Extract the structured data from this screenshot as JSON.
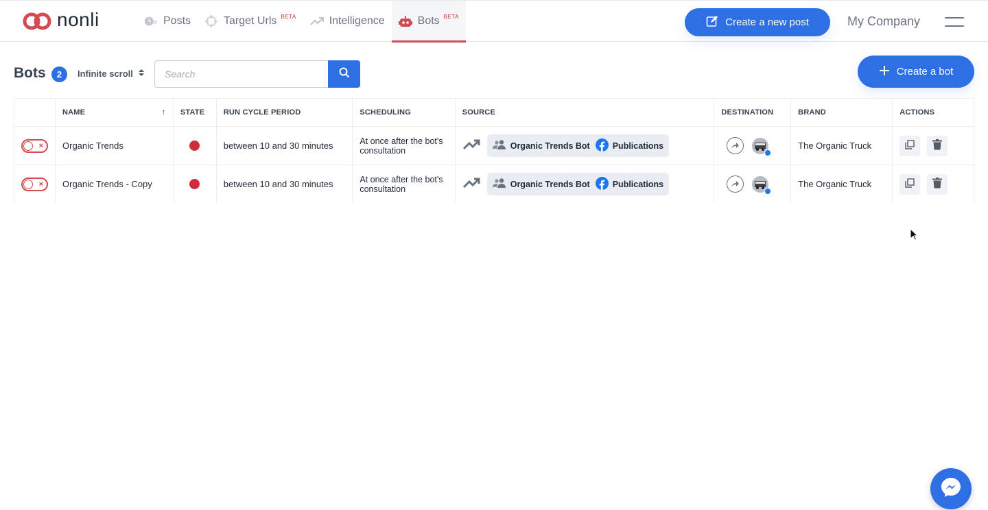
{
  "brand": {
    "name": "nonli",
    "accent": "#2f6fe4",
    "danger": "#d44a52"
  },
  "nav": {
    "items": [
      {
        "label": "Posts",
        "beta": "",
        "icon": "clock-icon"
      },
      {
        "label": "Target Urls",
        "beta": "BETA",
        "icon": "crosshair-icon"
      },
      {
        "label": "Intelligence",
        "beta": "",
        "icon": "trend-icon"
      },
      {
        "label": "Bots",
        "beta": "BETA",
        "icon": "robot-icon",
        "active": true
      }
    ],
    "create_post_label": "Create a new post",
    "company": "My Company"
  },
  "toolbar": {
    "title": "Bots",
    "count": "2",
    "scroll_mode": "Infinite scroll",
    "search_placeholder": "Search",
    "create_bot_label": "Create a bot"
  },
  "table": {
    "headers": [
      "NAME",
      "STATE",
      "RUN CYCLE PERIOD",
      "SCHEDULING",
      "SOURCE",
      "DESTINATION",
      "BRAND",
      "ACTIONS"
    ],
    "rows": [
      {
        "name": "Organic Trends",
        "enabled": false,
        "state": "stopped",
        "run_cycle": "between 10 and 30 minutes",
        "scheduling": "At once after the bot's consultation",
        "source_group": "Organic Trends Bot",
        "source_type": "Publications",
        "brand": "The Organic Truck"
      },
      {
        "name": "Organic Trends - Copy",
        "enabled": false,
        "state": "stopped",
        "run_cycle": "between 10 and 30 minutes",
        "scheduling": "At once after the bot's consultation",
        "source_group": "Organic Trends Bot",
        "source_type": "Publications",
        "brand": "The Organic Truck"
      }
    ]
  }
}
